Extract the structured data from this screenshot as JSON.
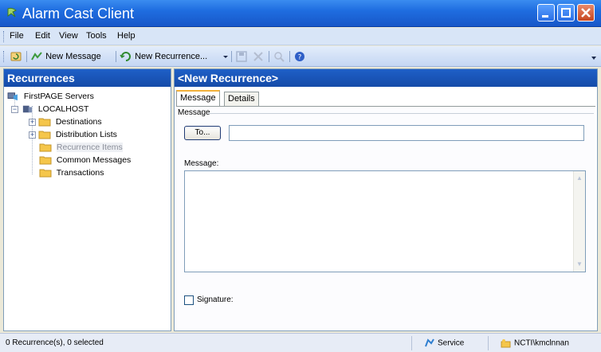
{
  "window": {
    "title": "Alarm Cast Client",
    "controls": [
      "minimize",
      "maximize",
      "close"
    ]
  },
  "menu": {
    "items": [
      "File",
      "Edit",
      "View",
      "Tools",
      "Help"
    ]
  },
  "toolbar": {
    "new_message_label": "New Message",
    "new_recurrence_label": "New Recurrence...",
    "icons": [
      "refresh-icon",
      "new-message-icon",
      "new-recurrence-icon",
      "save-icon",
      "delete-icon",
      "search-icon",
      "help-icon"
    ]
  },
  "left_pane": {
    "title": "Recurrences",
    "tree": {
      "root": "FirstPAGE Servers",
      "server": "LOCALHOST",
      "items": [
        {
          "label": "Destinations",
          "expandable": true
        },
        {
          "label": "Distribution Lists",
          "expandable": true
        },
        {
          "label": "Recurrence Items",
          "expandable": false,
          "selected": true
        },
        {
          "label": "Common Messages",
          "expandable": false
        },
        {
          "label": "Transactions",
          "expandable": false
        }
      ]
    }
  },
  "right_pane": {
    "title": "<New Recurrence>",
    "tabs": [
      "Message",
      "Details"
    ],
    "active_tab": "Message",
    "group_label": "Message",
    "to_button": "To...",
    "to_value": "",
    "message_label": "Message:",
    "message_value": "",
    "signature_label": "Signature:",
    "signature_checked": false
  },
  "status_bar": {
    "selection": "0 Recurrence(s), 0 selected",
    "service": "Service",
    "user": "NCTI\\kmclnnan"
  },
  "colors": {
    "title_bar": "#1f6de0",
    "pane_header": "#1a56bb",
    "active_tab_accent": "#f2b13b",
    "folder": "#f5c64a"
  }
}
